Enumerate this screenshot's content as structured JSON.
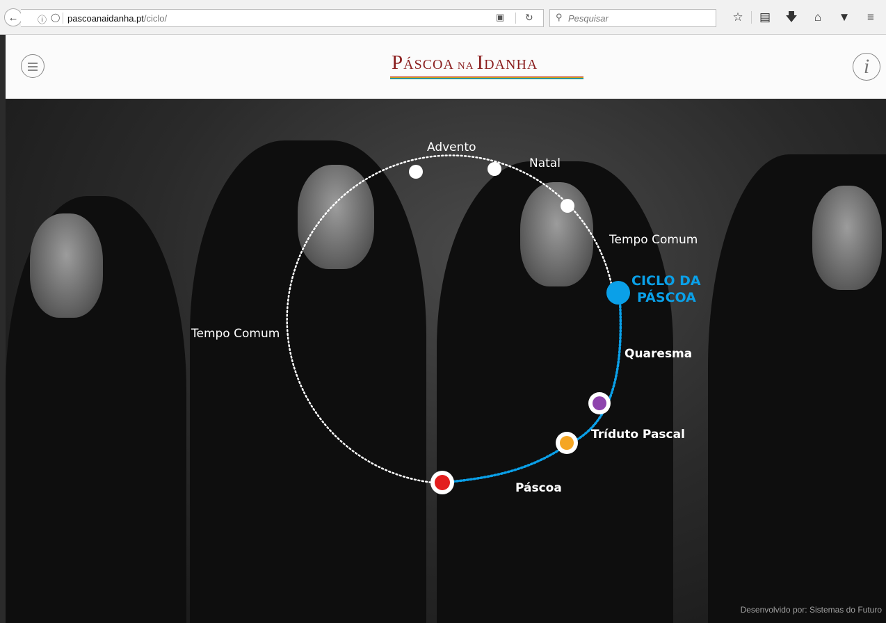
{
  "browser": {
    "url_domain": "pascoanaidanha.pt",
    "url_path": "/ciclo/",
    "search_placeholder": "Pesquisar"
  },
  "header": {
    "logo_part1": "P",
    "logo_part1_small": "ÁSCOA ",
    "logo_part2_small": "NA ",
    "logo_part3": "I",
    "logo_part3_small": "DANHA",
    "info_label": "i"
  },
  "cycle": {
    "labels": {
      "advento": "Advento",
      "natal": "Natal",
      "tempo_comum_right": "Tempo Comum",
      "tempo_comum_left": "Tempo Comum",
      "ciclo_line1": "CICLO DA",
      "ciclo_line2": "PÁSCOA",
      "quaresma": "Quaresma",
      "triduo": "Tríduto Pascal",
      "pascoa": "Páscoa"
    },
    "colors": {
      "ciclo": "#0aa0e8",
      "quaresma_dot": "#8e44ad",
      "triduo_dot": "#f5a623",
      "pascoa_dot": "#e31e1e"
    }
  },
  "footer": {
    "credit": "Desenvolvido por: Sistemas do Futuro"
  }
}
